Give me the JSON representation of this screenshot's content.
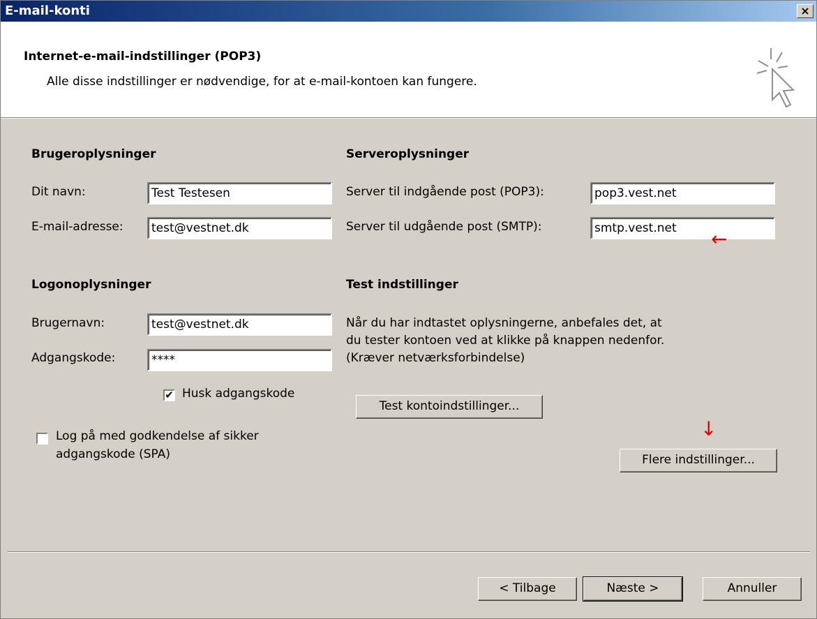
{
  "window": {
    "title": "E-mail-konti",
    "close_glyph": "×"
  },
  "header": {
    "title": "Internet-e-mail-indstillinger (POP3)",
    "subtitle": "Alle disse indstillinger er nødvendige, for at e-mail-kontoen kan fungere.",
    "icon": "wizard-cursor-icon"
  },
  "user_info": {
    "heading": "Brugeroplysninger",
    "name_label": "Dit navn:",
    "name_value": "Test Testesen",
    "email_label": "E-mail-adresse:",
    "email_value": "test@vestnet.dk"
  },
  "logon_info": {
    "heading": "Logonoplysninger",
    "username_label": "Brugernavn:",
    "username_value": "test@vestnet.dk",
    "password_label": "Adgangskode:",
    "password_value": "****",
    "remember_label": "Husk adgangskode",
    "remember_checked": true,
    "spa_label_line1": "Log på med godkendelse af sikker",
    "spa_label_line2": "adgangskode (SPA)",
    "spa_checked": false
  },
  "server_info": {
    "heading": "Serveroplysninger",
    "incoming_label": "Server til indgående post (POP3):",
    "incoming_value": "pop3.vest.net",
    "outgoing_label": "Server til udgående post (SMTP):",
    "outgoing_value": "smtp.vest.net"
  },
  "test_settings": {
    "heading": "Test indstillinger",
    "desc_line1": "Når du har indtastet oplysningerne, anbefales det, at",
    "desc_line2": "du tester kontoen ved at klikke på knappen nedenfor.",
    "desc_line3": "(Kræver netværksforbindelse)",
    "test_button": "Test kontoindstillinger...",
    "more_button": "Flere indstillinger..."
  },
  "annotations": {
    "left_arrow": "←",
    "down_arrow": "↓",
    "color": "#e00000"
  },
  "footer": {
    "back_button": "< Tilbage",
    "next_button": "Næste >",
    "cancel_button": "Annuller"
  }
}
